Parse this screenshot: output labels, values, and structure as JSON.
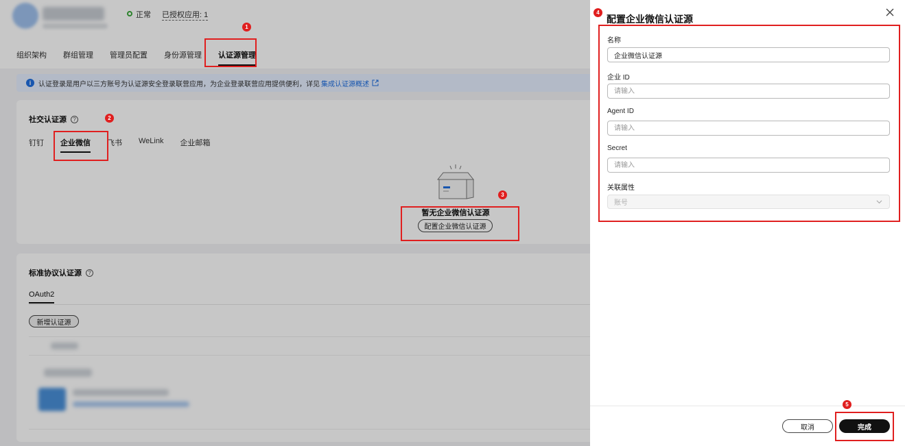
{
  "header": {
    "status": "正常",
    "authorized_apps": "已授权应用: 1"
  },
  "top_tabs": [
    {
      "label": "组织架构"
    },
    {
      "label": "群组管理"
    },
    {
      "label": "管理员配置"
    },
    {
      "label": "身份源管理"
    },
    {
      "label": "认证源管理",
      "active": true
    }
  ],
  "info_bar": {
    "text": "认证登录是用户以三方账号为认证源安全登录联营应用，为企业登录联营应用提供便利，详见",
    "link": "集成认证源概述"
  },
  "social_section": {
    "title": "社交认证源",
    "tabs": [
      {
        "label": "钉钉"
      },
      {
        "label": "企业微信",
        "active": true
      },
      {
        "label": "飞书"
      },
      {
        "label": "WeLink"
      },
      {
        "label": "企业邮箱"
      }
    ],
    "empty_title": "暂无企业微信认证源",
    "empty_button": "配置企业微信认证源"
  },
  "standard_section": {
    "title": "标准协议认证源",
    "tab": "OAuth2",
    "add_button": "新增认证源"
  },
  "drawer": {
    "title": "配置企业微信认证源",
    "fields": {
      "name_label": "名称",
      "name_value": "企业微信认证源",
      "corp_id_label": "企业 ID",
      "corp_id_placeholder": "请输入",
      "agent_id_label": "Agent ID",
      "agent_id_placeholder": "请输入",
      "secret_label": "Secret",
      "secret_placeholder": "请输入",
      "attr_label": "关联属性",
      "attr_value": "账号"
    },
    "cancel_label": "取消",
    "done_label": "完成"
  },
  "annotations": [
    "1",
    "2",
    "3",
    "4",
    "5"
  ],
  "colors": {
    "annotation_red": "#e01e1e",
    "link_blue": "#1f6fe0",
    "primary_button": "#111111",
    "status_green": "#3aa83a"
  }
}
